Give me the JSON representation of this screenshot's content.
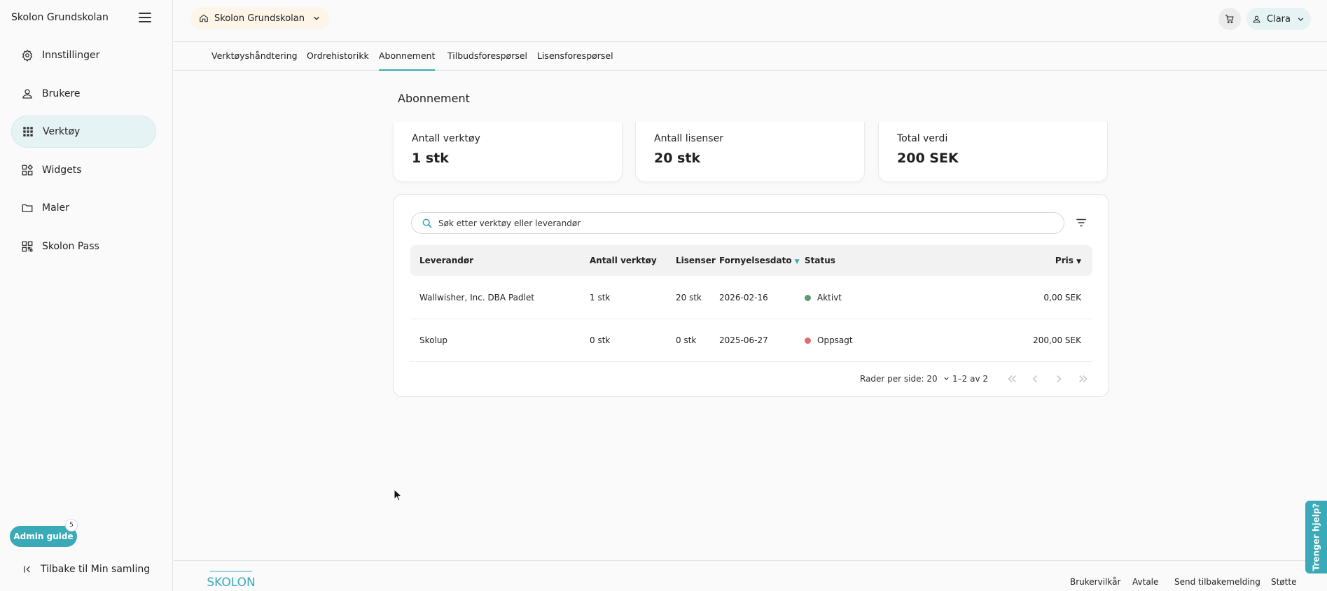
{
  "sidebar": {
    "title": "Skolon Grundskolan",
    "items": [
      {
        "label": "Innstillinger",
        "icon": "gear-icon"
      },
      {
        "label": "Brukere",
        "icon": "user-icon"
      },
      {
        "label": "Verktøy",
        "icon": "grid-icon",
        "active": true
      },
      {
        "label": "Widgets",
        "icon": "widgets-icon"
      },
      {
        "label": "Maler",
        "icon": "folder-icon"
      },
      {
        "label": "Skolon Pass",
        "icon": "qr-icon"
      }
    ],
    "admin_guide": "Admin guide",
    "admin_badge": "5",
    "back": "Tilbake til Min samling"
  },
  "topbar": {
    "school": "Skolon Grundskolan",
    "user": "Clara"
  },
  "tabs": [
    "Verktøyshåndtering",
    "Ordrehistorikk",
    "Abonnement",
    "Tilbudsforespørsel",
    "Lisensforespørsel"
  ],
  "page": {
    "title": "Abonnement",
    "stats": [
      {
        "label": "Antall verktøy",
        "value": "1 stk"
      },
      {
        "label": "Antall lisenser",
        "value": "20 stk"
      },
      {
        "label": "Total verdi",
        "value": "200 SEK"
      }
    ]
  },
  "search": {
    "placeholder": "Søk etter verktøy eller leverandør"
  },
  "table": {
    "headers": [
      "Leverandør",
      "Antall verktøy",
      "Lisenser",
      "Fornyelsesdato",
      "Status",
      "Pris"
    ],
    "rows": [
      {
        "vendor": "Wallwisher, Inc. DBA Padlet",
        "tools": "1 stk",
        "licenses": "20 stk",
        "date": "2026-02-16",
        "status": "Aktivt",
        "status_color": "#5a9e6f",
        "price": "0,00 SEK"
      },
      {
        "vendor": "Skolup",
        "tools": "0 stk",
        "licenses": "0 stk",
        "date": "2025-06-27",
        "status": "Oppsagt",
        "status_color": "#e06d6d",
        "price": "200,00 SEK"
      }
    ]
  },
  "pagination": {
    "rows_per_page": "Rader per side: 20",
    "range": "1–2 av 2"
  },
  "footer": {
    "links": [
      "Brukervilkår",
      "Avtale",
      "Send tilbakemelding",
      "Støtte"
    ],
    "logo": "SKOLON"
  },
  "help": "Trenger hjelp?",
  "colors": {
    "accent": "#3aa9b8",
    "active_nav": "#e6f3f5",
    "school_chip": "#fdf6e8"
  }
}
